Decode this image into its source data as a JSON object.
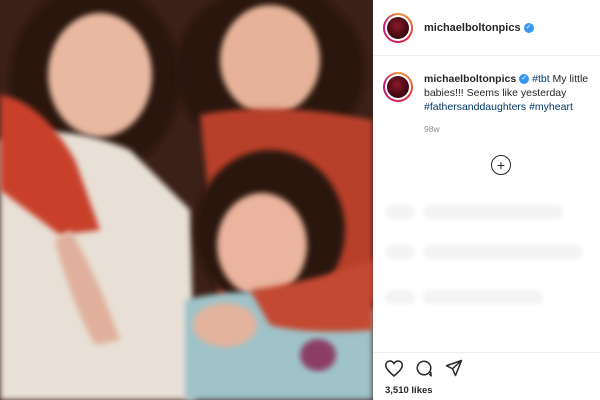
{
  "post": {
    "username": "michaelboltonpics",
    "verified_glyph": "✓"
  },
  "caption": {
    "username": "michaelboltonpics",
    "text_before": " ",
    "tag1": "#tbt",
    "text_main": " My little babies!!! Seems like yesterday ",
    "tag2": "#fathersanddaughters",
    "tag3": "#myheart",
    "time": "98w"
  },
  "load_more_glyph": "+",
  "actions": {
    "likes": "3,510 likes",
    "icons": [
      "heart-icon",
      "comment-icon",
      "share-icon"
    ]
  },
  "colors": {
    "verified": "#3897f0",
    "hashtag": "#003569",
    "muted": "#8e8e8e"
  }
}
